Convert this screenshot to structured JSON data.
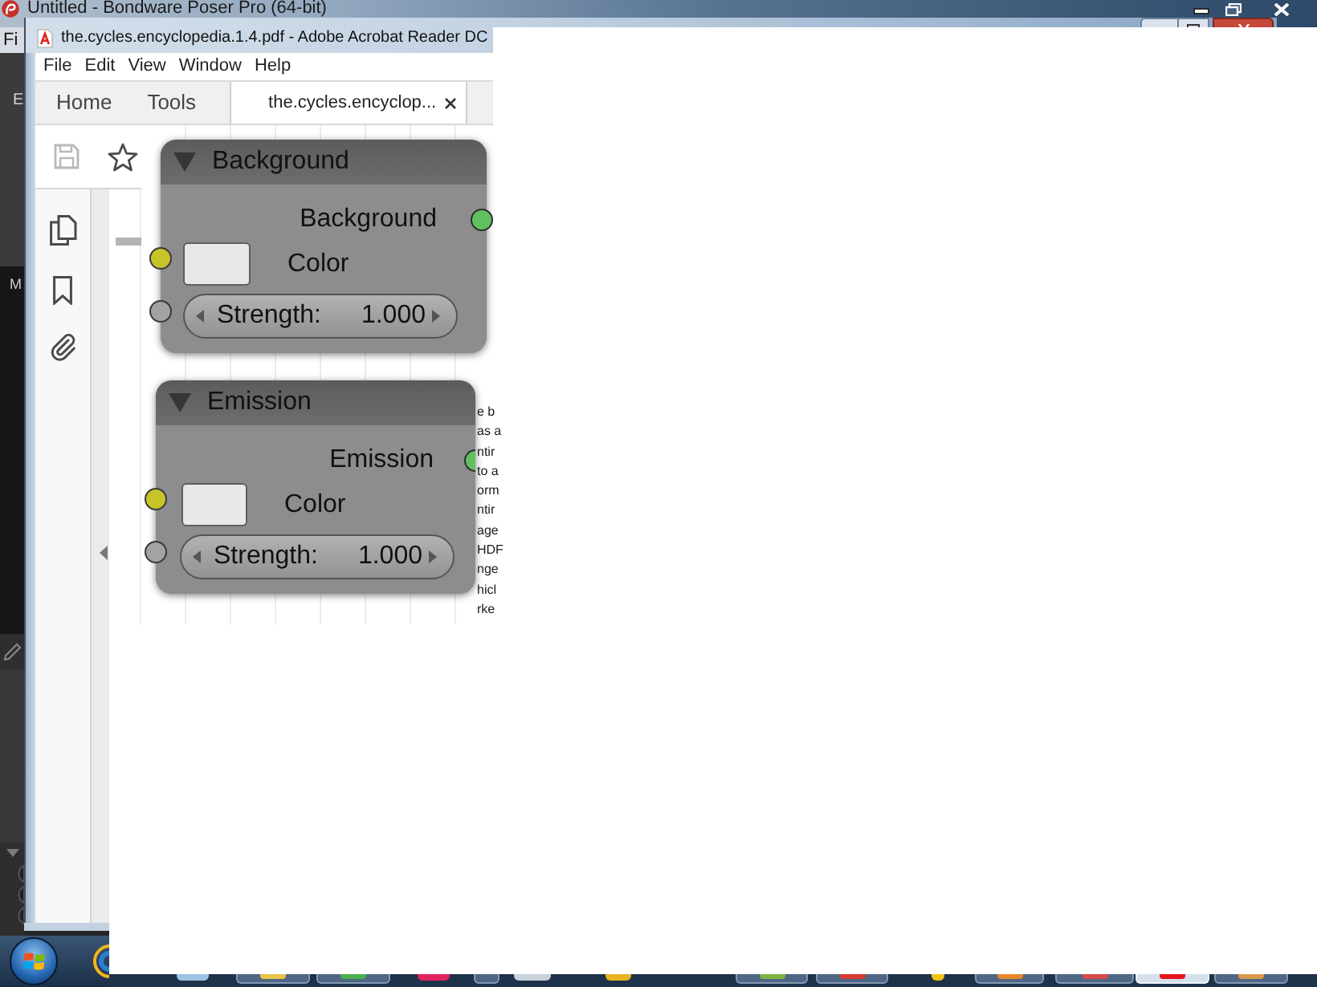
{
  "background_app": {
    "title": "Untitled - Bondware Poser Pro (64-bit)",
    "menu": [
      "Fi"
    ],
    "labels": [
      "E",
      "M"
    ]
  },
  "window": {
    "title": "the.cycles.encyclopedia.1.4.pdf - Adobe Acrobat Reader DC"
  },
  "menu": [
    "File",
    "Edit",
    "View",
    "Window",
    "Help"
  ],
  "tabs": [
    {
      "label": "Home",
      "selected": false,
      "closable": false
    },
    {
      "label": "Tools",
      "selected": false,
      "closable": false
    },
    {
      "label": "the.cycles.encyclop...",
      "selected": true,
      "closable": true
    }
  ],
  "toolbar": [
    {
      "kind": "save",
      "disabled": true
    },
    {
      "kind": "star",
      "disabled": false
    }
  ],
  "sidebar": [
    {
      "kind": "pages"
    },
    {
      "kind": "bookmark"
    },
    {
      "kind": "attachment"
    }
  ],
  "nodes": [
    {
      "title": "Background",
      "expanded": true,
      "output": "Background",
      "inputs": [
        {
          "kind": "color",
          "label": "Color",
          "color": "#e8e8e8"
        },
        {
          "kind": "number",
          "label": "Strength:",
          "value": "1.000"
        }
      ]
    },
    {
      "title": "Emission",
      "expanded": true,
      "output": "Emission",
      "inputs": [
        {
          "kind": "color",
          "label": "Color",
          "color": "#e8e8e8"
        },
        {
          "kind": "number",
          "label": "Strength:",
          "value": "1.000"
        }
      ]
    }
  ],
  "page_text": [
    "e b",
    "as a",
    "ntir",
    "to a",
    "orm",
    "ntir",
    "age",
    "HDF",
    "nge",
    "hicl",
    "rke"
  ],
  "taskbar": {
    "items": [
      {
        "kind": "pinned",
        "selected": false,
        "color": "#9cc3e6"
      },
      {
        "kind": "window",
        "selected": false,
        "color": "#e8c34a"
      },
      {
        "kind": "window",
        "selected": false,
        "color": "#4caf50"
      },
      {
        "kind": "pinned",
        "selected": false,
        "color": "#e0245e"
      },
      {
        "kind": "window",
        "selected": false
      },
      {
        "kind": "pinned",
        "selected": false,
        "color": "#c9d1da"
      },
      {
        "kind": "pinned",
        "selected": false,
        "color": "#e6b422"
      },
      {
        "kind": "window",
        "selected": false,
        "color": "#7cb342"
      },
      {
        "kind": "window",
        "selected": false,
        "color": "#d93b30"
      },
      {
        "kind": "pinned",
        "selected": false,
        "color": "#f2c21b"
      },
      {
        "kind": "window",
        "selected": false,
        "color": "#e8862a"
      },
      {
        "kind": "window",
        "selected": false,
        "color": "#d84a4a"
      },
      {
        "kind": "window",
        "selected": true,
        "color": "#e3161b"
      },
      {
        "kind": "window",
        "selected": false,
        "color": "#d9984a"
      }
    ]
  }
}
